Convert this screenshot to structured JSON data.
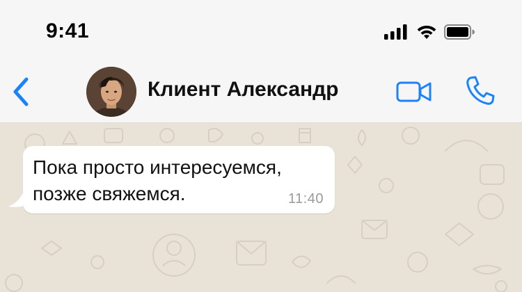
{
  "status_bar": {
    "time": "9:41",
    "icons": [
      "signal-icon",
      "wifi-icon",
      "battery-icon"
    ]
  },
  "header": {
    "back_icon": "chevron-left-icon",
    "contact_name": "Клиент Александр",
    "actions": [
      "video-call-icon",
      "phone-icon"
    ],
    "accent_color": "#1a82fb"
  },
  "chat": {
    "messages": [
      {
        "direction": "incoming",
        "text_line_1": "Пока просто интересуемся,",
        "text_line_2": "позже свяжемся.",
        "time": "11:40"
      }
    ],
    "wallpaper_color": "#e9e2d6"
  }
}
